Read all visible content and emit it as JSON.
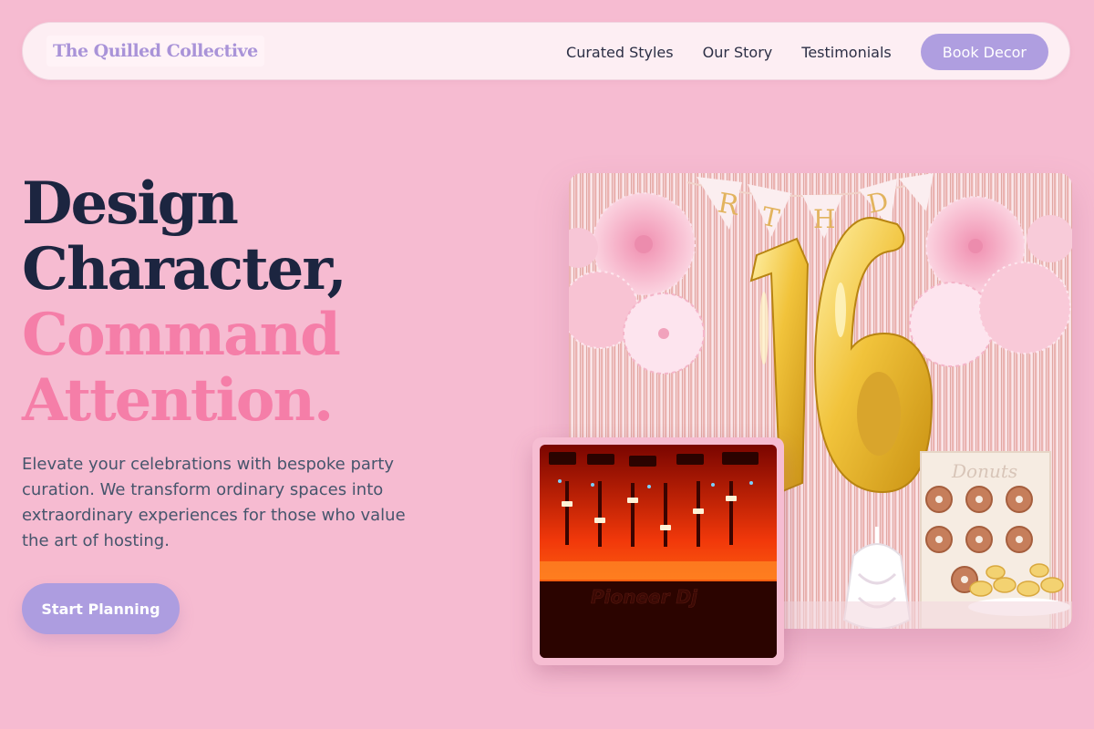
{
  "nav": {
    "logo": "The Quilled Collective",
    "links": [
      "Curated Styles",
      "Our Story",
      "Testimonials"
    ],
    "book_label": "Book Decor"
  },
  "hero": {
    "title_line1": "Design",
    "title_line2": "Character,",
    "title_line3": "Command",
    "title_line4": "Attention.",
    "description": "Elevate your celebrations with bespoke party curation. We transform ordinary spaces into extraordinary experiences for those who value the art of hosting.",
    "cta_label": "Start Planning"
  },
  "images": {
    "main": {
      "banner_letters": [
        "R",
        "T",
        "H",
        "D"
      ],
      "balloon_number": "16",
      "sign_text": "Donuts"
    },
    "secondary": {
      "brand_text": "Pioneer Dj"
    }
  },
  "colors": {
    "background": "#f6bbd1",
    "accent": "#af9ee0",
    "heading_dark": "#1c2540",
    "heading_pink": "#f57ea8"
  }
}
